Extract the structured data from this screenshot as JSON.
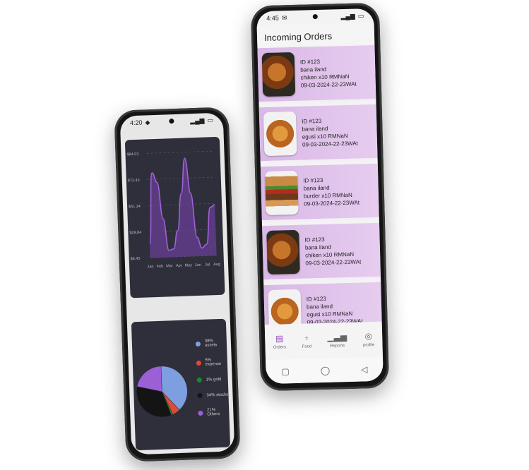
{
  "orders_phone": {
    "status": {
      "time": "4:45",
      "battery": ""
    },
    "title": "Incoming Orders",
    "orders": [
      {
        "id": "ID #123",
        "location": "bana iland",
        "item": "chiken x10 RMNaN",
        "datetime": "09-03-2024-22-23WAt",
        "image": "chicken"
      },
      {
        "id": "ID #123",
        "location": "bana iland",
        "item": "egusi x10 RMNaN",
        "datetime": "09-03-2024-22-23WAt",
        "image": "egusi"
      },
      {
        "id": "ID #123",
        "location": "bana iland",
        "item": "burder x10 RMNaN",
        "datetime": "09-03-2024-22-23WAt",
        "image": "burger"
      },
      {
        "id": "ID #123",
        "location": "bana iland",
        "item": "chiken x10 RMNaN",
        "datetime": "09-03-2024-22-23WAt",
        "image": "chicken"
      },
      {
        "id": "ID #123",
        "location": "bana iland",
        "item": "egusi x10 RMNaN",
        "datetime": "09-03-2024-22-23WAt",
        "image": "egusi"
      }
    ],
    "nav": [
      {
        "label": "Orders",
        "icon": "orders-icon",
        "active": true
      },
      {
        "label": "Food",
        "icon": "food-icon",
        "active": false
      },
      {
        "label": "Reports",
        "icon": "reports-icon",
        "active": false
      },
      {
        "label": "profile",
        "icon": "profile-icon",
        "active": false
      }
    ]
  },
  "dash_phone": {
    "status": {
      "time": "4:20"
    }
  },
  "chart_data": [
    {
      "type": "area",
      "title": "",
      "xlabel": "",
      "ylabel": "",
      "categories": [
        "Jan",
        "Feb",
        "Mar",
        "Apr",
        "May",
        "Jun",
        "Jul",
        "Aug"
      ],
      "y_ticks": [
        "$94.03",
        "$72.43",
        "$51.24",
        "$29.84",
        "$8.45"
      ],
      "ylim": [
        8.45,
        94.03
      ],
      "x": [
        0,
        0.5,
        1,
        1.5,
        2,
        2.5,
        3,
        3.5,
        4,
        4.5,
        5,
        5.5,
        6,
        6.5,
        7
      ],
      "values": [
        20,
        78,
        70,
        40,
        14,
        15,
        30,
        60,
        89,
        60,
        24,
        15,
        18,
        48,
        50
      ],
      "grid": true,
      "colors": {
        "line": "#9d62d8",
        "fill": "#6a3f95",
        "bg": "#2f2f3b"
      }
    },
    {
      "type": "pie",
      "labels": [
        "38% assets",
        "5% expense",
        "1% gold",
        "34% stocks",
        "21% Others"
      ],
      "values": [
        38,
        5,
        1,
        34,
        21
      ],
      "colors": [
        "#7d9fe0",
        "#e04a35",
        "#1c8a2a",
        "#141414",
        "#9b5fd6"
      ],
      "legend": "right"
    }
  ]
}
